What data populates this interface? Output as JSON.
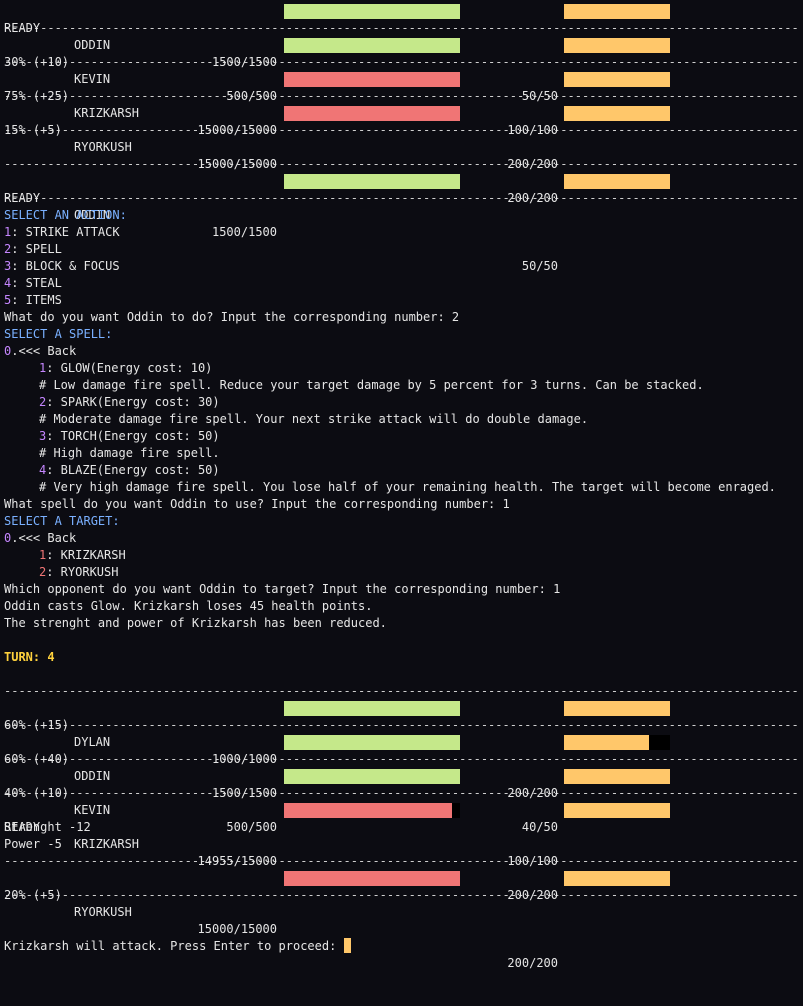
{
  "separator": "-------------------------------------------------------------------------------------------------------------------",
  "top_status": [
    {
      "status": "READY",
      "name": "ODDIN",
      "hp": "1500/1500",
      "hp_frac": 1.0,
      "hp_color": "#c5e88a",
      "energy": "50/50",
      "energy_frac": 1.0
    },
    {
      "status": "30% (+10)",
      "name": "KEVIN",
      "hp": "500/500",
      "hp_frac": 1.0,
      "hp_color": "#c5e88a",
      "energy": "100/100",
      "energy_frac": 1.0
    },
    {
      "status": "75% (+25)",
      "name": "KRIZKARSH",
      "hp": "15000/15000",
      "hp_frac": 1.0,
      "hp_color": "#f07575",
      "energy": "200/200",
      "energy_frac": 1.0
    },
    {
      "status": "15% (+5)",
      "name": "RYORKUSH",
      "hp": "15000/15000",
      "hp_frac": 1.0,
      "hp_color": "#f07575",
      "energy": "200/200",
      "energy_frac": 1.0
    }
  ],
  "active": {
    "status": "READY",
    "name": "ODDIN",
    "hp": "1500/1500",
    "hp_frac": 1.0,
    "hp_color": "#c5e88a",
    "energy": "50/50",
    "energy_frac": 1.0
  },
  "action_menu": {
    "header": "SELECT AN ACTION:",
    "options": [
      {
        "num": "1",
        "label": ": STRIKE ATTACK"
      },
      {
        "num": "2",
        "label": ": SPELL"
      },
      {
        "num": "3",
        "label": ": BLOCK & FOCUS"
      },
      {
        "num": "4",
        "label": ": STEAL"
      },
      {
        "num": "5",
        "label": ": ITEMS"
      }
    ],
    "prompt": "What do you want Oddin to do? Input the corresponding number: 2"
  },
  "spell_menu": {
    "header": "SELECT A SPELL:",
    "back_num": "0",
    "back_label": ".<<< Back",
    "spells": [
      {
        "num": "1",
        "label": ": GLOW(Energy cost: 10)",
        "desc": "# Low damage fire spell. Reduce your target damage by 5 percent for 3 turns. Can be stacked."
      },
      {
        "num": "2",
        "label": ": SPARK(Energy cost: 30)",
        "desc": "# Moderate damage fire spell. Your next strike attack will do double damage."
      },
      {
        "num": "3",
        "label": ": TORCH(Energy cost: 50)",
        "desc": "# High damage fire spell."
      },
      {
        "num": "4",
        "label": ": BLAZE(Energy cost: 50)",
        "desc": "# Very high damage fire spell. You lose half of your remaining health. The target will become enraged."
      }
    ],
    "prompt": "What spell do you want Oddin to use? Input the corresponding number: 1"
  },
  "target_menu": {
    "header": "SELECT A TARGET:",
    "back_num": "0",
    "back_label": ".<<< Back",
    "targets": [
      {
        "num": "1",
        "label": ": KRIZKARSH"
      },
      {
        "num": "2",
        "label": ": RYORKUSH"
      }
    ],
    "prompt": "Which opponent do you want Oddin to target? Input the corresponding number: 1"
  },
  "result_lines": [
    "Oddin casts Glow. Krizkarsh loses 45 health points.",
    "The strenght and power of Krizkarsh has been reduced."
  ],
  "turn_label": "TURN: 4",
  "bottom_status": [
    {
      "status": "60% (+15)",
      "name": "DYLAN",
      "hp": "1000/1000",
      "hp_frac": 1.0,
      "hp_color": "#c5e88a",
      "energy": "200/200",
      "energy_frac": 1.0,
      "effects": []
    },
    {
      "status": "60% (+40)",
      "name": "ODDIN",
      "hp": "1500/1500",
      "hp_frac": 1.0,
      "hp_color": "#c5e88a",
      "energy": "40/50",
      "energy_frac": 0.8,
      "effects": []
    },
    {
      "status": "40% (+10)",
      "name": "KEVIN",
      "hp": "500/500",
      "hp_frac": 1.0,
      "hp_color": "#c5e88a",
      "energy": "100/100",
      "energy_frac": 1.0,
      "effects": []
    },
    {
      "status": "READY",
      "name": "KRIZKARSH",
      "hp": "14955/15000",
      "hp_frac": 0.955,
      "hp_color": "#f07575",
      "energy": "200/200",
      "energy_frac": 1.0,
      "effects": [
        "Strenght -12",
        "Power -5"
      ]
    },
    {
      "status": "20% (+5)",
      "name": "RYORKUSH",
      "hp": "15000/15000",
      "hp_frac": 1.0,
      "hp_color": "#f07575",
      "energy": "200/200",
      "energy_frac": 1.0,
      "effects": []
    }
  ],
  "input_prompt": "Krizkarsh will attack. Press Enter to proceed: ",
  "colors": {
    "background": "#0c0c12",
    "hp_ally": "#c5e88a",
    "hp_enemy": "#f07575",
    "energy": "#ffc76a",
    "menu_header": "#7ab0ff",
    "menu_number": "#c586ff",
    "target_number": "#f07575",
    "turn": "#ffd23d"
  }
}
